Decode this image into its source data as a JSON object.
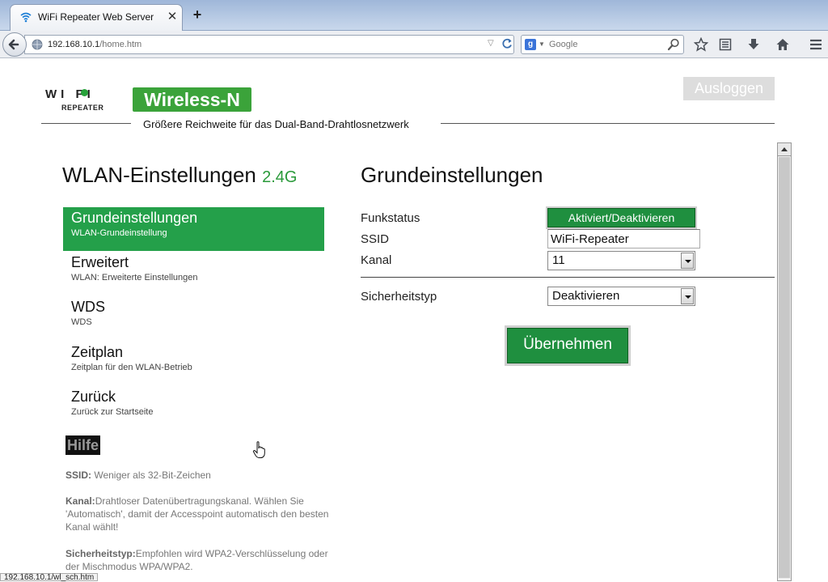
{
  "browser": {
    "tab_title": "WiFi Repeater Web Server",
    "url_host": "192.168.10.1",
    "url_path": "/home.htm",
    "search_placeholder": "Google",
    "status_text": "192.168.10.1/wl_sch.htm"
  },
  "header": {
    "logo_wifi": "WI  FI",
    "logo_repeater": "REPEATER",
    "badge": "Wireless-N",
    "tagline": "Größere Reichweite für das Dual-Band-Drahtlosnetzwerk",
    "logout_label": "Ausloggen"
  },
  "sidebar": {
    "title": "WLAN-Einstellungen",
    "band": "2.4G",
    "items": [
      {
        "label": "Grundeinstellungen",
        "sub": "WLAN-Grundeinstellung"
      },
      {
        "label": "Erweitert",
        "sub": "WLAN: Erweiterte Einstellungen"
      },
      {
        "label": "WDS",
        "sub": "WDS"
      },
      {
        "label": "Zeitplan",
        "sub": "Zeitplan für den WLAN-Betrieb"
      },
      {
        "label": "Zurück",
        "sub": "Zurück zur Startseite"
      }
    ]
  },
  "help": {
    "heading": "Hilfe",
    "ssid_term": "SSID:",
    "ssid_text": " Weniger als 32-Bit-Zeichen",
    "kanal_term": "Kanal:",
    "kanal_text": "Drahtloser Datenübertragungskanal. Wählen Sie 'Automatisch', damit der Accesspoint automatisch den besten Kanal wählt!",
    "sec_term": "Sicherheitstyp:",
    "sec_text": "Empfohlen wird WPA2-Verschlüsselung oder der Mischmodus WPA/WPA2."
  },
  "main": {
    "title": "Grundeinstellungen",
    "funkstatus_label": "Funkstatus",
    "funkstatus_button": "Aktiviert/Deaktivieren",
    "ssid_label": "SSID",
    "ssid_value": "WiFi-Repeater",
    "kanal_label": "Kanal",
    "kanal_value": "11",
    "security_label": "Sicherheitstyp",
    "security_value": "Deaktivieren",
    "apply_label": "Übernehmen"
  },
  "colors": {
    "accent_green": "#24a04a",
    "button_green": "#1f8f3f"
  }
}
